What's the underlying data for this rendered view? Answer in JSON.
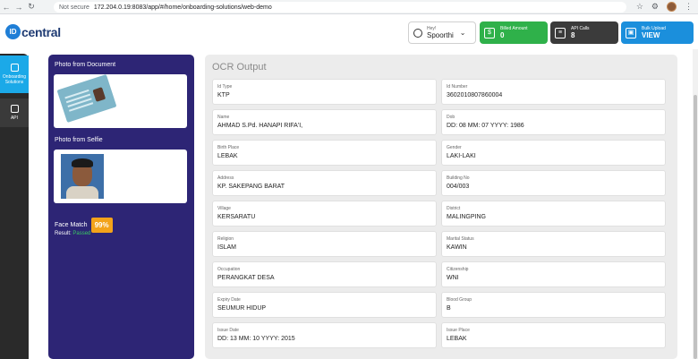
{
  "browser": {
    "security": "Not secure",
    "url": "172.204.0.19:8083/app/#/home/onboarding-solutions/web-demo"
  },
  "header": {
    "logo_letters": "ID",
    "logo_text": "central",
    "user": {
      "greeting": "Hey!",
      "name": "Spoorthi"
    },
    "stats": [
      {
        "label": "Billed Amount",
        "value": "0",
        "icon": "dollar-icon",
        "color": "#2fb14a"
      },
      {
        "label": "API Calls",
        "value": "8",
        "icon": "api-calls-icon",
        "color": "#3b3b3b"
      },
      {
        "label": "Bulk Upload",
        "value": "VIEW",
        "icon": "box-icon",
        "color": "#1b8fdc"
      }
    ]
  },
  "sidebar": {
    "items": [
      {
        "label": "Onboarding Solutions",
        "icon": "onboarding-icon",
        "active": true
      },
      {
        "label": "API",
        "icon": "api-icon",
        "active": false
      }
    ]
  },
  "photos": {
    "document_title": "Photo from Document",
    "selfie_title": "Photo from Selfie",
    "face_match_label": "Face Match",
    "face_match_value": "99%",
    "result_label": "Result:",
    "result_value": "Passed"
  },
  "ocr": {
    "title": "OCR Output",
    "fields": [
      {
        "label": "Id Type",
        "value": "KTP"
      },
      {
        "label": "Id Number",
        "value": "3602010807860004"
      },
      {
        "label": "Name",
        "value": "AHMAD S.Pd. HANAPI RIFA'I,"
      },
      {
        "label": "Dob",
        "value": "DD: 08 MM: 07 YYYY: 1986"
      },
      {
        "label": "Birth Place",
        "value": "LEBAK"
      },
      {
        "label": "Gender",
        "value": "LAKI-LAKI"
      },
      {
        "label": "Address",
        "value": "KP. SAKEPANG BARAT"
      },
      {
        "label": "Building No",
        "value": "004/003"
      },
      {
        "label": "Village",
        "value": "KERSARATU"
      },
      {
        "label": "District",
        "value": "MALINGPING"
      },
      {
        "label": "Religion",
        "value": "ISLAM"
      },
      {
        "label": "Marital Status",
        "value": "KAWIN"
      },
      {
        "label": "Occupation",
        "value": "PERANGKAT DESA"
      },
      {
        "label": "Citizenship",
        "value": "WNI"
      },
      {
        "label": "Expiry Date",
        "value": "SEUMUR HIDUP"
      },
      {
        "label": "Blood Group",
        "value": "B"
      },
      {
        "label": "Issue Date",
        "value": "DD: 13 MM: 10 YYYY: 2015"
      },
      {
        "label": "Issue Place",
        "value": "LEBAK"
      }
    ]
  }
}
